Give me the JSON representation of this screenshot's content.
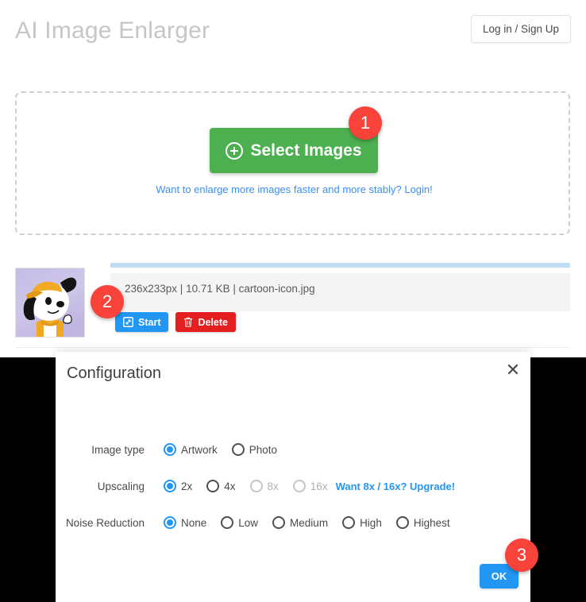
{
  "header": {
    "title": "AI Image Enlarger",
    "login_label": "Log in / Sign Up"
  },
  "dropzone": {
    "select_label": "Select Images",
    "plus_icon": "plus-circle-icon",
    "upsell_text": "Want to enlarge more images faster and more stably? Login!"
  },
  "file_row": {
    "meta": "236x233px | 10.71 KB | cartoon-icon.jpg",
    "dimensions": "236x233px",
    "size": "10.71 KB",
    "filename": "cartoon-icon.jpg",
    "progress_percent": 100,
    "start_label": "Start",
    "start_icon": "expand-arrows-icon",
    "delete_label": "Delete",
    "delete_icon": "trash-icon",
    "thumbnail_alt": "cartoon dog with yellow cap"
  },
  "dialog": {
    "title": "Configuration",
    "close_icon": "close-icon",
    "close_label": "✕",
    "ok_label": "OK",
    "rows": [
      {
        "label": "Image type",
        "name": "image-type",
        "options": [
          {
            "label": "Artwork",
            "checked": true,
            "disabled": false
          },
          {
            "label": "Photo",
            "checked": false,
            "disabled": false
          }
        ]
      },
      {
        "label": "Upscaling",
        "name": "upscaling",
        "options": [
          {
            "label": "2x",
            "checked": true,
            "disabled": false
          },
          {
            "label": "4x",
            "checked": false,
            "disabled": false
          },
          {
            "label": "8x",
            "checked": false,
            "disabled": true
          },
          {
            "label": "16x",
            "checked": false,
            "disabled": true
          }
        ],
        "link": "Want 8x / 16x? Upgrade!"
      },
      {
        "label": "Noise Reduction",
        "name": "noise-reduction",
        "options": [
          {
            "label": "None",
            "checked": true,
            "disabled": false
          },
          {
            "label": "Low",
            "checked": false,
            "disabled": false
          },
          {
            "label": "Medium",
            "checked": false,
            "disabled": false
          },
          {
            "label": "High",
            "checked": false,
            "disabled": false
          },
          {
            "label": "Highest",
            "checked": false,
            "disabled": false
          }
        ]
      }
    ]
  },
  "badges": [
    {
      "number": "1"
    },
    {
      "number": "2"
    },
    {
      "number": "3"
    }
  ],
  "colors": {
    "accent_blue": "#2196f3",
    "green": "#4caf50",
    "red": "#e41f1f",
    "badge_red": "#f9423a",
    "link_blue": "#3d8ef0"
  }
}
